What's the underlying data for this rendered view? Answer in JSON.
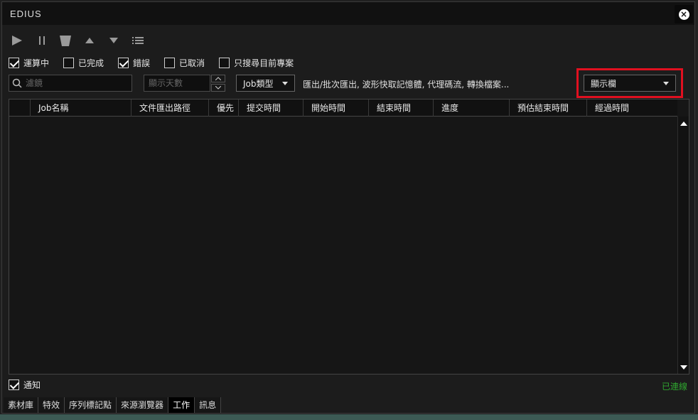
{
  "window": {
    "title": "EDIUS",
    "close_icon": "close-icon"
  },
  "toolbar": {
    "icons": [
      "play-icon",
      "pause-icon",
      "delete-icon",
      "move-up-icon",
      "move-down-icon",
      "list-icon"
    ]
  },
  "filters": [
    {
      "label": "運算中",
      "checked": true
    },
    {
      "label": "已完成",
      "checked": false
    },
    {
      "label": "錯誤",
      "checked": true
    },
    {
      "label": "已取消",
      "checked": false
    },
    {
      "label": "只搜尋目前專案",
      "checked": false
    }
  ],
  "search": {
    "placeholder": "濾鏡"
  },
  "days": {
    "placeholder": "顯示天數"
  },
  "job_type": {
    "label": "Job類型"
  },
  "job_type_desc": "匯出/批次匯出, 波形快取記憶體, 代理碼流, 轉換檔案...",
  "columns_dropdown": {
    "label": "顯示欄"
  },
  "table": {
    "columns": [
      "",
      "Job名稱",
      "文件匯出路徑",
      "優先",
      "提交時間",
      "開始時間",
      "結束時間",
      "進度",
      "預估結束時間",
      "經過時間"
    ],
    "rows": []
  },
  "notify": {
    "label": "通知",
    "checked": true
  },
  "status": {
    "text": "已連線",
    "color": "#2fa62f"
  },
  "tabs": [
    {
      "label": "素材庫",
      "active": false
    },
    {
      "label": "特效",
      "active": false
    },
    {
      "label": "序列標記點",
      "active": false
    },
    {
      "label": "來源瀏覽器",
      "active": false
    },
    {
      "label": "工作",
      "active": true
    },
    {
      "label": "訊息",
      "active": false
    }
  ],
  "colors": {
    "highlight": "#e01020",
    "background": "#1c1c1c"
  }
}
